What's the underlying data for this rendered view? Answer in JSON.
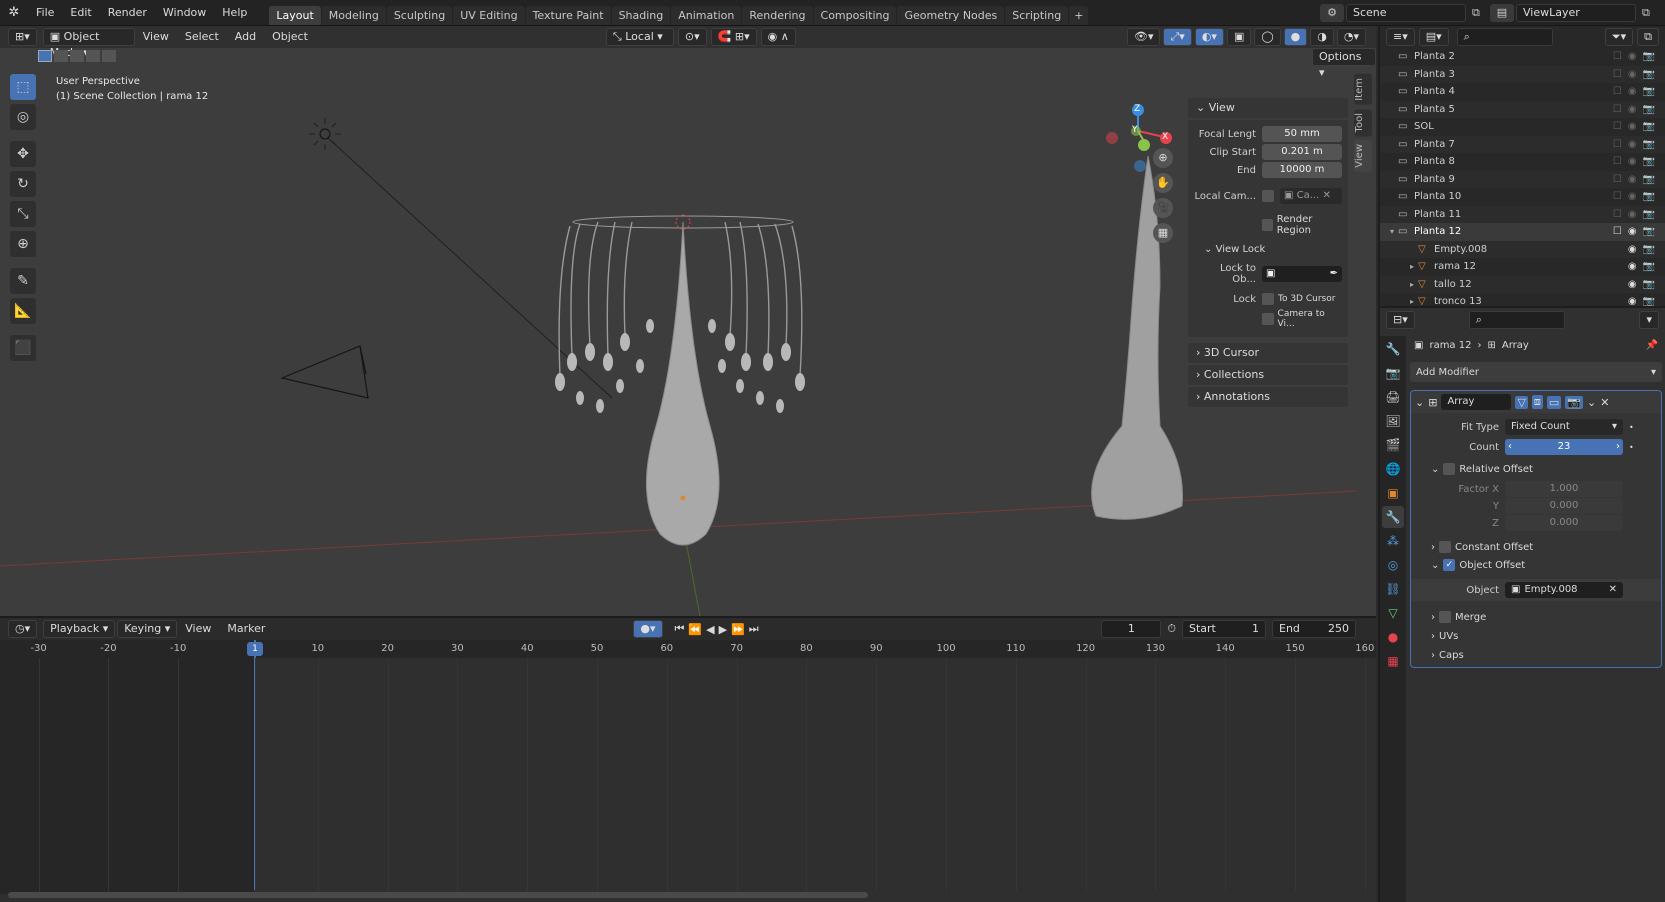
{
  "menu": [
    "File",
    "Edit",
    "Render",
    "Window",
    "Help"
  ],
  "workspaces": [
    "Layout",
    "Modeling",
    "Sculpting",
    "UV Editing",
    "Texture Paint",
    "Shading",
    "Animation",
    "Rendering",
    "Compositing",
    "Geometry Nodes",
    "Scripting"
  ],
  "active_workspace": "Layout",
  "scene": "Scene",
  "view_layer": "ViewLayer",
  "viewport": {
    "mode": "Object Mode",
    "menus": [
      "View",
      "Select",
      "Add",
      "Object"
    ],
    "orientation": "Local",
    "options": "Options",
    "overlay_title": "User Perspective",
    "overlay_sub": "(1) Scene Collection | rama 12",
    "gizmo": {
      "x": "X",
      "y": "Y",
      "z": "Z"
    }
  },
  "npanel": {
    "header": "View",
    "focal_label": "Focal Lengt",
    "focal": "50 mm",
    "clip_start_label": "Clip Start",
    "clip_start": "0.201 m",
    "end_label": "End",
    "end": "10000 m",
    "local_cam_label": "Local Cam...",
    "local_cam_value": "Ca...",
    "render_region": "Render Region",
    "view_lock": "View Lock",
    "lock_obj_label": "Lock to Ob...",
    "lock_label": "Lock",
    "to_3d_cursor": "To 3D Cursor",
    "camera_to_view": "Camera to Vi...",
    "sections": [
      "3D Cursor",
      "Collections",
      "Annotations"
    ],
    "tabs": [
      "Item",
      "Tool",
      "View"
    ]
  },
  "timeline": {
    "menus": [
      "Playback",
      "Keying",
      "View",
      "Marker"
    ],
    "current_frame": "1",
    "start_label": "Start",
    "start": "1",
    "end_label": "End",
    "end": "250",
    "ticks": [
      "-30",
      "-20",
      "-10",
      "1",
      "10",
      "20",
      "30",
      "40",
      "50",
      "60",
      "70",
      "80",
      "90",
      "100",
      "110",
      "120",
      "130",
      "140",
      "150",
      "160"
    ]
  },
  "outliner": {
    "rows": [
      {
        "name": "Planta 2",
        "indent": 0
      },
      {
        "name": "Planta 3",
        "indent": 0
      },
      {
        "name": "Planta 4",
        "indent": 0
      },
      {
        "name": "Planta 5",
        "indent": 0
      },
      {
        "name": "SOL",
        "indent": 0
      },
      {
        "name": "Planta 7",
        "indent": 0
      },
      {
        "name": "Planta 8",
        "indent": 0
      },
      {
        "name": "Planta 9",
        "indent": 0
      },
      {
        "name": "Planta 10",
        "indent": 0
      },
      {
        "name": "Planta 11",
        "indent": 0
      },
      {
        "name": "Planta 12",
        "indent": 0
      },
      {
        "name": "Empty.008",
        "indent": 1
      },
      {
        "name": "rama 12",
        "indent": 1
      },
      {
        "name": "tallo 12",
        "indent": 1
      },
      {
        "name": "tronco 13",
        "indent": 1
      }
    ]
  },
  "properties": {
    "breadcrumb_object": "rama 12",
    "breadcrumb_modifier": "Array",
    "add_modifier": "Add Modifier",
    "modifier_name": "Array",
    "fit_type_label": "Fit Type",
    "fit_type": "Fixed Count",
    "count_label": "Count",
    "count": "23",
    "relative_offset": "Relative Offset",
    "factor_x_label": "Factor X",
    "factor_x": "1.000",
    "y_label": "Y",
    "factor_y": "0.000",
    "z_label": "Z",
    "factor_z": "0.000",
    "constant_offset": "Constant Offset",
    "object_offset": "Object Offset",
    "object_label": "Object",
    "object_value": "Empty.008",
    "merge": "Merge",
    "uvs": "UVs",
    "caps": "Caps"
  },
  "colors": {
    "accent": "#4772b3",
    "x_axis": "#e8424d",
    "y_axis": "#8bc34a",
    "z_axis": "#3a8de0",
    "orange": "#e0882f"
  }
}
